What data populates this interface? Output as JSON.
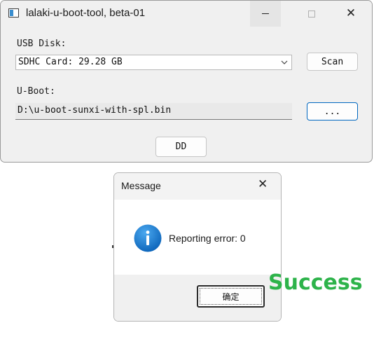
{
  "main_window": {
    "title": "lalaki-u-boot-tool, beta-01",
    "usb_disk_label": "USB Disk:",
    "usb_disk_selected": "SDHC Card: 29.28 GB",
    "scan_label": "Scan",
    "uboot_label": "U-Boot:",
    "uboot_path": "D:\\u-boot-sunxi-with-spl.bin",
    "browse_label": "...",
    "dd_label": "DD"
  },
  "message_box": {
    "title": "Message",
    "text": "Reporting error: 0",
    "ok_label": "确定",
    "icon": "info-icon"
  },
  "overlay": {
    "success_text": "Success",
    "success_color": "#2db34a"
  },
  "colors": {
    "accent": "#0067c0",
    "info_icon_blue": "#1a7fd4"
  }
}
